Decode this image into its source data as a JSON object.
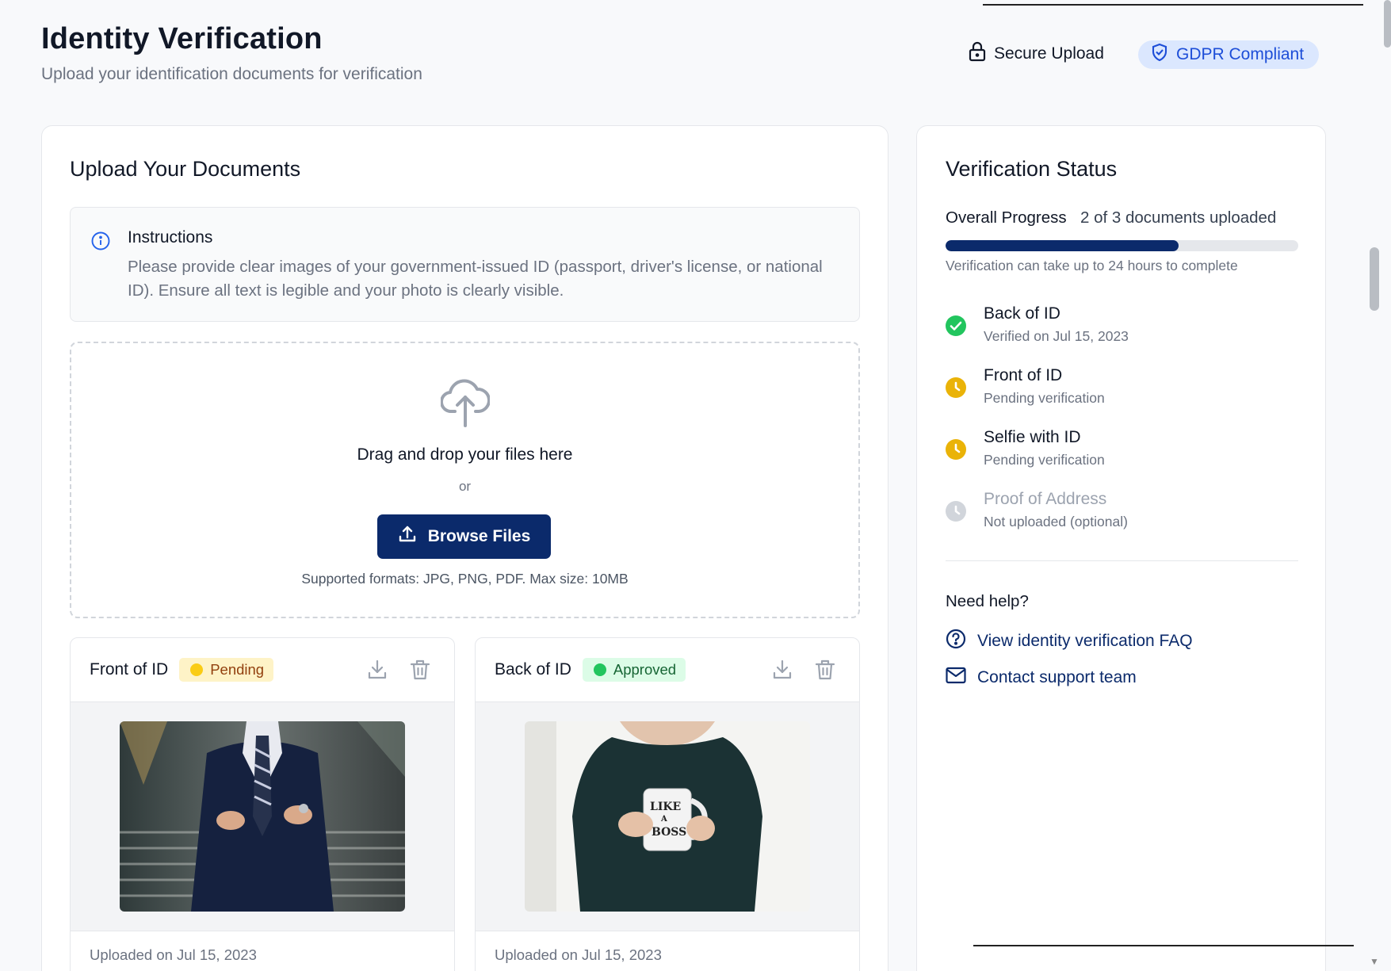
{
  "header": {
    "title": "Identity Verification",
    "subtitle": "Upload your identification documents for verification",
    "secure_label": "Secure Upload",
    "gdpr_label": "GDPR Compliant"
  },
  "upload": {
    "title": "Upload Your Documents",
    "instructions_title": "Instructions",
    "instructions_text": "Please provide clear images of your government-issued ID (passport, driver's license, or national ID). Ensure all text is legible and your photo is clearly visible.",
    "drop_title": "Drag and drop your files here",
    "drop_or": "or",
    "browse_label": "Browse Files",
    "formats": "Supported formats: JPG, PNG, PDF. Max size: 10MB"
  },
  "documents": [
    {
      "name": "Front of ID",
      "status": "Pending",
      "uploaded": "Uploaded on Jul 15, 2023",
      "image": "man-in-suit-photo"
    },
    {
      "name": "Back of ID",
      "status": "Approved",
      "uploaded": "Uploaded on Jul 15, 2023",
      "image": "woman-holding-mug-photo"
    }
  ],
  "status": {
    "title": "Verification Status",
    "progress_label": "Overall Progress",
    "progress_count": "2 of 3 documents uploaded",
    "progress_fraction": 0.66,
    "note": "Verification can take up to 24 hours to complete",
    "steps": [
      {
        "title": "Back of ID",
        "sub": "Verified on Jul 15, 2023",
        "state": "verified"
      },
      {
        "title": "Front of ID",
        "sub": "Pending verification",
        "state": "pending"
      },
      {
        "title": "Selfie with ID",
        "sub": "Pending verification",
        "state": "pending"
      },
      {
        "title": "Proof of Address",
        "sub": "Not uploaded (optional)",
        "state": "missing"
      }
    ],
    "help_title": "Need help?",
    "faq_label": "View identity verification FAQ",
    "support_label": "Contact support team"
  },
  "colors": {
    "brand": "#0b2a6b",
    "pending": "#eab308",
    "approved": "#22c55e"
  },
  "icons": {
    "secure": "lock-icon",
    "gdpr": "shield-check-icon",
    "instructions": "info-icon",
    "drop": "cloud-upload-icon",
    "browse": "upload-icon",
    "download": "download-icon",
    "delete": "trash-icon",
    "faq": "question-circle-icon",
    "support": "mail-icon"
  }
}
